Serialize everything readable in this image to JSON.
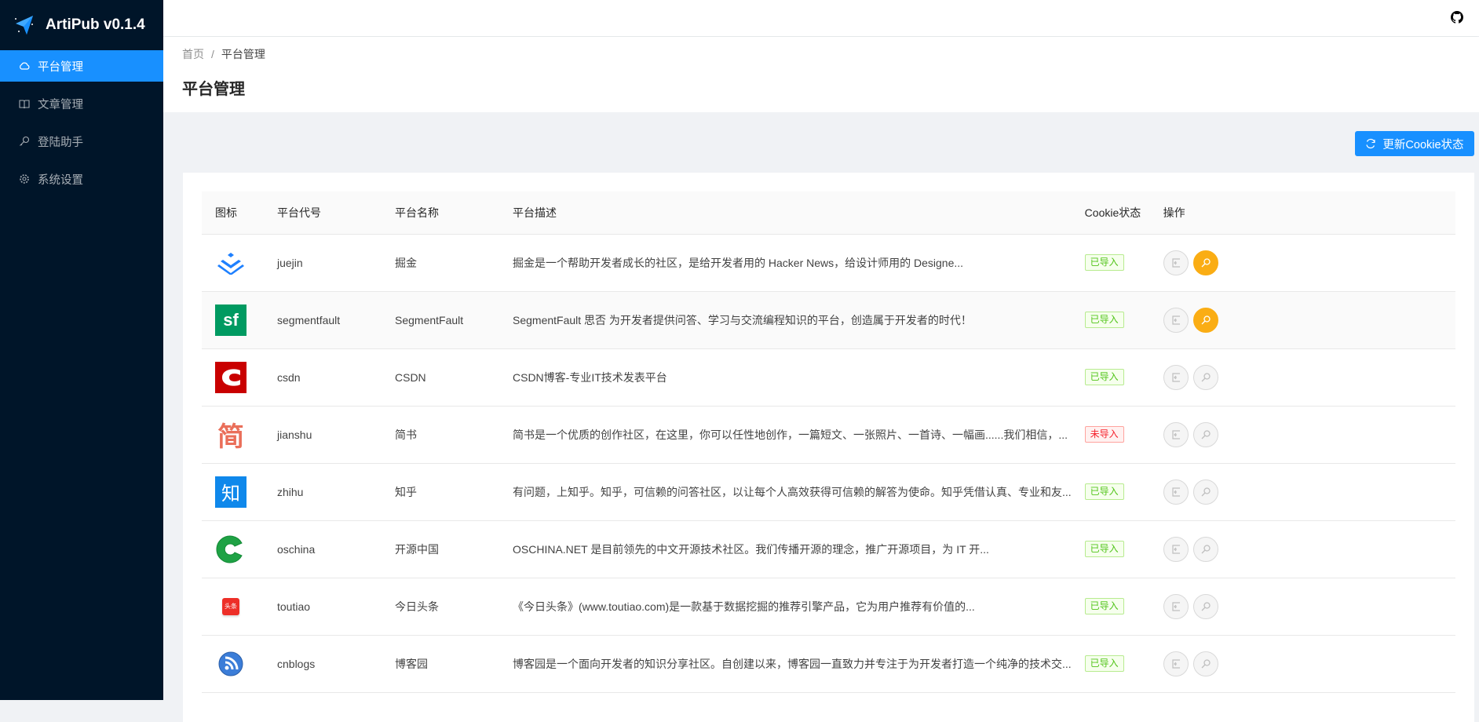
{
  "app": {
    "title": "ArtiPub v0.1.4"
  },
  "sidebar": {
    "items": [
      {
        "label": "平台管理",
        "icon": "cloud-icon",
        "active": true
      },
      {
        "label": "文章管理",
        "icon": "book-icon"
      },
      {
        "label": "登陆助手",
        "icon": "key-icon"
      },
      {
        "label": "系统设置",
        "icon": "gear-icon"
      }
    ]
  },
  "breadcrumb": {
    "home": "首页",
    "sep": "/",
    "current": "平台管理"
  },
  "page": {
    "title": "平台管理",
    "refresh_label": "更新Cookie状态"
  },
  "table": {
    "headers": [
      "图标",
      "平台代号",
      "平台名称",
      "平台描述",
      "Cookie状态",
      "操作"
    ],
    "rows": [
      {
        "code": "juejin",
        "name": "掘金",
        "desc": "掘金是一个帮助开发者成长的社区，是给开发者用的 Hacker News，给设计师用的 Designe...",
        "status": "已导入",
        "ok": true,
        "active": true
      },
      {
        "code": "segmentfault",
        "name": "SegmentFault",
        "desc": "SegmentFault 思否 为开发者提供问答、学习与交流编程知识的平台，创造属于开发者的时代！",
        "status": "已导入",
        "ok": true,
        "active": true
      },
      {
        "code": "csdn",
        "name": "CSDN",
        "desc": "CSDN博客-专业IT技术发表平台",
        "status": "已导入",
        "ok": true,
        "active": false
      },
      {
        "code": "jianshu",
        "name": "简书",
        "desc": "简书是一个优质的创作社区，在这里，你可以任性地创作，一篇短文、一张照片、一首诗、一幅画......我们相信，...",
        "status": "未导入",
        "ok": false,
        "active": false
      },
      {
        "code": "zhihu",
        "name": "知乎",
        "desc": "有问题，上知乎。知乎，可信赖的问答社区，以让每个人高效获得可信赖的解答为使命。知乎凭借认真、专业和友...",
        "status": "已导入",
        "ok": true,
        "active": false
      },
      {
        "code": "oschina",
        "name": "开源中国",
        "desc": "OSCHINA.NET 是目前领先的中文开源技术社区。我们传播开源的理念，推广开源项目，为 IT 开...",
        "status": "已导入",
        "ok": true,
        "active": false
      },
      {
        "code": "toutiao",
        "name": "今日头条",
        "desc": "《今日头条》(www.toutiao.com)是一款基于数据挖掘的推荐引擎产品，它为用户推荐有价值的...",
        "status": "已导入",
        "ok": true,
        "active": false
      },
      {
        "code": "cnblogs",
        "name": "博客园",
        "desc": "博客园是一个面向开发者的知识分享社区。自创建以来，博客园一直致力并专注于为开发者打造一个纯净的技术交...",
        "status": "已导入",
        "ok": true,
        "active": false
      }
    ]
  },
  "colors": {
    "primary": "#1890ff",
    "sider": "#001529",
    "warning": "#faad14"
  }
}
